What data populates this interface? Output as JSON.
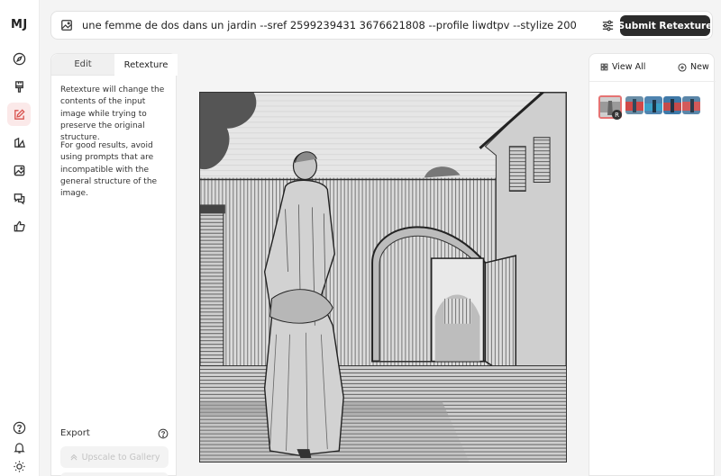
{
  "logo": "MJ",
  "prompt": {
    "text": "une femme de dos dans un jardin --sref 2599239431 3676621808 --profile liwdtpv --stylize 200",
    "submit_label": "Submit Retexture"
  },
  "left_panel": {
    "tabs": [
      {
        "label": "Edit"
      },
      {
        "label": "Retexture"
      }
    ],
    "description_1": "Retexture will change the contents of the input image while trying to preserve the original structure.",
    "description_2": "For good results, avoid using prompts that are incompatible with the general structure of the image.",
    "export_label": "Export",
    "upscale_label": "Upscale to Gallery"
  },
  "right_panel": {
    "view_all_label": "View All",
    "new_label": "New",
    "thumb_badge": "R"
  },
  "colors": {
    "accent": "#e57373",
    "submit_bg": "#2b2b2b"
  },
  "icons": {
    "rail": [
      "compass-icon",
      "brush-icon",
      "edit-icon",
      "layers-icon",
      "image-icon",
      "chat-icon",
      "thumbs-up-icon"
    ],
    "rail_bottom": [
      "help-icon",
      "bell-icon",
      "sun-icon"
    ]
  }
}
